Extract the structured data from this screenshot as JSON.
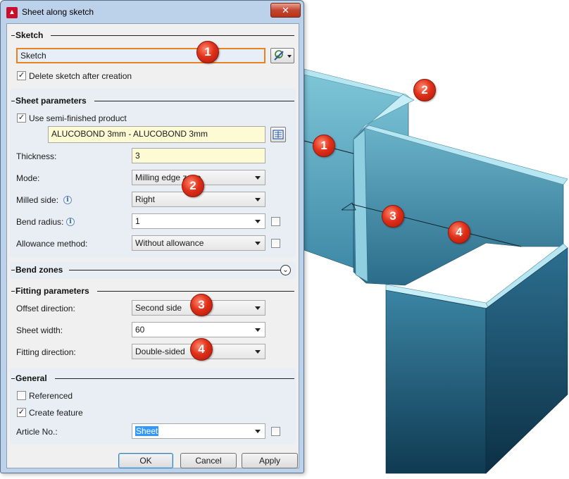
{
  "window": {
    "title": "Sheet along sketch",
    "close_glyph": "✕"
  },
  "sections": {
    "sketch": "Sketch",
    "sheet_parameters": "Sheet parameters",
    "bend_zones": "Bend zones",
    "fitting_parameters": "Fitting parameters",
    "general": "General"
  },
  "sketch": {
    "value": "Sketch",
    "delete_after_creation_label": "Delete sketch after creation",
    "delete_after_creation_checked": true
  },
  "sheet_parameters": {
    "use_semi_finished_label": "Use semi-finished product",
    "use_semi_finished_checked": true,
    "product_value": "ALUCOBOND 3mm - ALUCOBOND 3mm",
    "thickness_label": "Thickness:",
    "thickness_value": "3",
    "mode_label": "Mode:",
    "mode_value": "Milling edge zone",
    "milled_side_label": "Milled side:",
    "milled_side_value": "Right",
    "bend_radius_label": "Bend radius:",
    "bend_radius_value": "1",
    "allowance_method_label": "Allowance method:",
    "allowance_method_value": "Without allowance"
  },
  "fitting_parameters": {
    "offset_direction_label": "Offset direction:",
    "offset_direction_value": "Second side",
    "sheet_width_label": "Sheet width:",
    "sheet_width_value": "60",
    "fitting_direction_label": "Fitting direction:",
    "fitting_direction_value": "Double-sided"
  },
  "general": {
    "referenced_label": "Referenced",
    "referenced_checked": false,
    "create_feature_label": "Create feature",
    "create_feature_checked": true,
    "article_no_label": "Article No.:",
    "article_no_value": "Sheet"
  },
  "buttons": {
    "ok": "OK",
    "cancel": "Cancel",
    "apply": "Apply"
  },
  "markers": {
    "dialog": [
      "1",
      "2",
      "3",
      "4"
    ],
    "model": [
      "1",
      "2",
      "3",
      "4"
    ]
  },
  "icons": {
    "app": "app-logo-icon",
    "sketch_pick": "sketch-pick-icon",
    "catalog": "catalog-icon",
    "info": "info-icon",
    "expand": "expand-chevron-icon"
  },
  "colors": {
    "title_bar": "#bcd1ea",
    "marker_red": "#e0301a",
    "input_highlight": "#e9821f",
    "yellow_field": "#fdfbd4",
    "model_top": "#aee3ef",
    "model_dark": "#0f3c52"
  }
}
